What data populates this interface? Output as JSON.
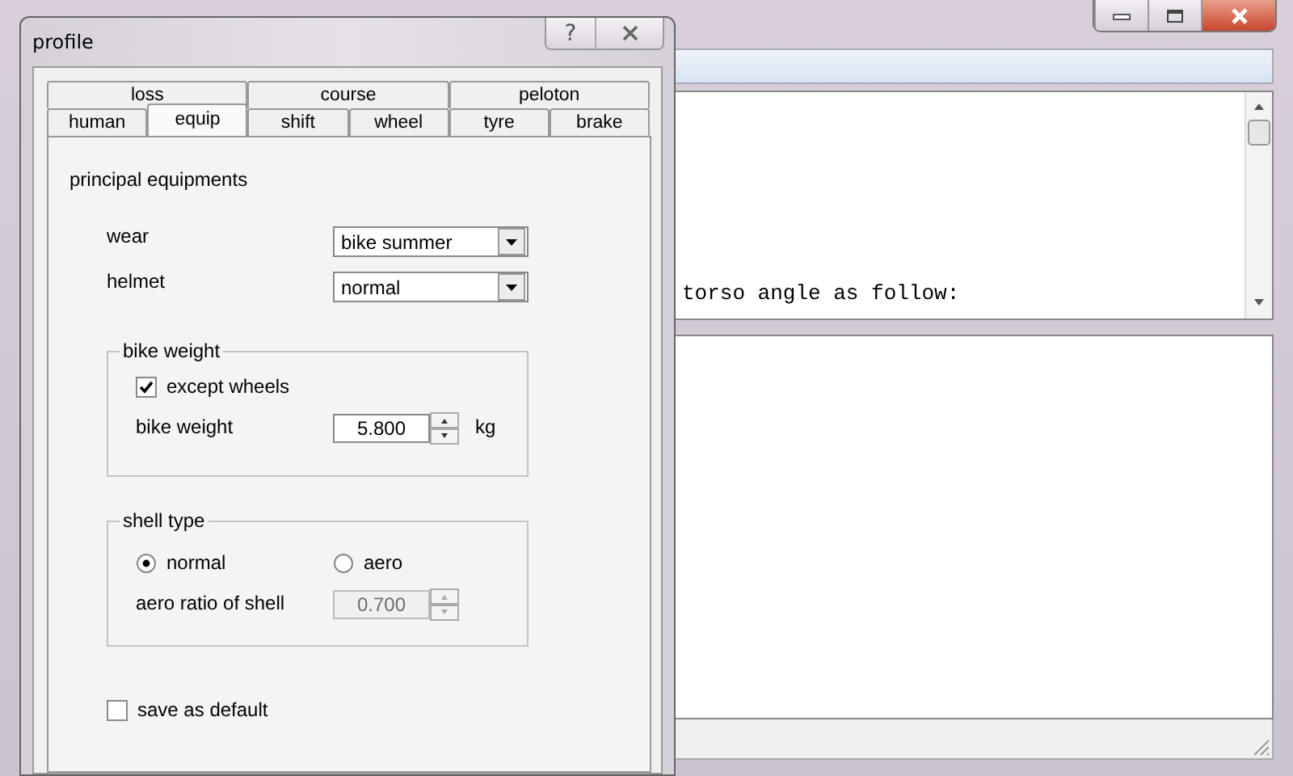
{
  "main_window": {
    "log_line": "torso angle as follow:"
  },
  "dialog": {
    "title": "profile",
    "help_button": "?",
    "tab_rows": [
      [
        {
          "label": "loss",
          "selected": false
        },
        {
          "label": "course",
          "selected": false
        },
        {
          "label": "peloton",
          "selected": false
        }
      ],
      [
        {
          "label": "human",
          "selected": false
        },
        {
          "label": "equip",
          "selected": true
        },
        {
          "label": "shift",
          "selected": false
        },
        {
          "label": "wheel",
          "selected": false
        },
        {
          "label": "tyre",
          "selected": false
        },
        {
          "label": "brake",
          "selected": false
        }
      ]
    ],
    "section_title": "principal equipments",
    "selects": [
      {
        "label": "wear",
        "value": "bike summer"
      },
      {
        "label": "helmet",
        "value": "normal"
      }
    ],
    "bike_weight_group": {
      "title": "bike weight",
      "except_wheels": {
        "label": "except wheels",
        "checked": true
      },
      "weight": {
        "label": "bike weight",
        "value": "5.800",
        "unit": "kg",
        "disabled": false
      }
    },
    "shell_group": {
      "title": "shell type",
      "options": [
        {
          "label": "normal",
          "selected": true
        },
        {
          "label": "aero",
          "selected": false
        }
      ],
      "ratio": {
        "label": "aero ratio of shell",
        "value": "0.700",
        "disabled": true
      }
    },
    "save_default": {
      "label": "save as default",
      "checked": false
    }
  }
}
